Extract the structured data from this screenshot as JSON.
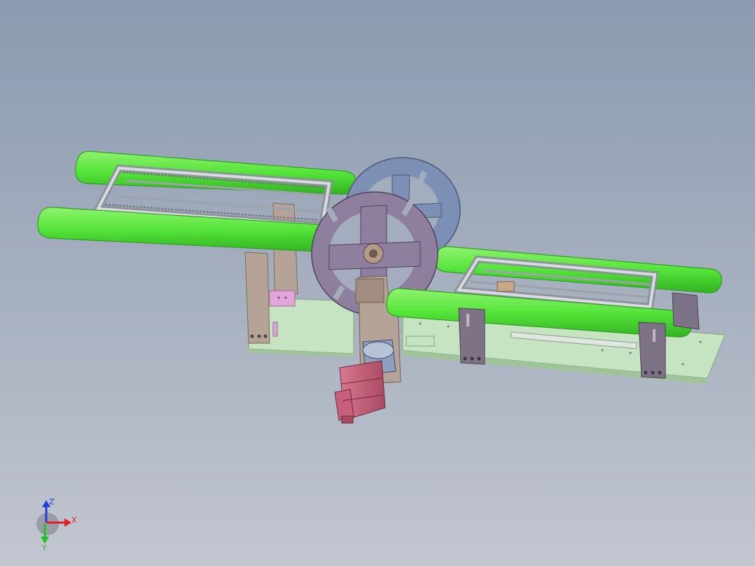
{
  "viewport": {
    "background_top": "#8a9bb1",
    "background_bottom": "#c2c6d0"
  },
  "model": {
    "colors": {
      "conveyor_belt": "#55e43a",
      "conveyor_belt_edge": "#2f9e22",
      "aluminum_profile": "#b9bcc4",
      "base_plate": "#c7e4c2",
      "base_plate_edge": "#7fa67a",
      "front_wheel": "#8e7f9e",
      "rear_wheel": "#7d8fb5",
      "support_post": "#b4a396",
      "motor": "#c7607c",
      "gearbox": "#8e9fbf",
      "mount_bracket": "#7e7287",
      "pink_block": "#e0a6d8"
    },
    "icons": [
      "rotary-wheel-icon",
      "stepper-motor-icon"
    ]
  },
  "triad": {
    "x_label": "X",
    "y_label": "Y",
    "z_label": "Z",
    "x_color": "#e02020",
    "y_color": "#20c020",
    "z_color": "#2040e0"
  }
}
